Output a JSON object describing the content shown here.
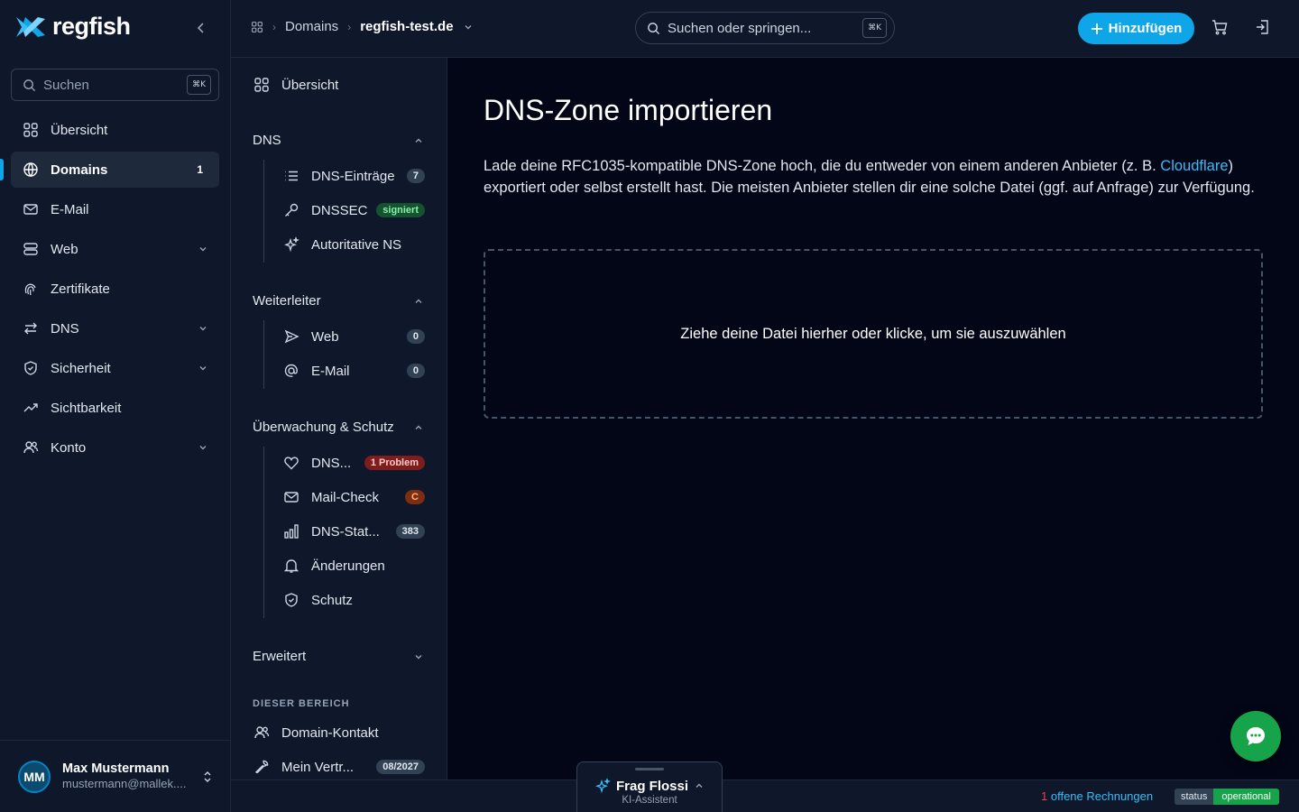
{
  "brand": {
    "name": "regfish",
    "accent": "#0ea5e9"
  },
  "sidebar": {
    "search_label": "Suchen",
    "kbd": "⌘K",
    "items": [
      {
        "label": "Übersicht",
        "icon": "grid-icon"
      },
      {
        "label": "Domains",
        "icon": "globe-icon",
        "badge": "1",
        "active": true
      },
      {
        "label": "E-Mail",
        "icon": "mail-icon"
      },
      {
        "label": "Web",
        "icon": "server-icon",
        "expandable": true
      },
      {
        "label": "Zertifikate",
        "icon": "fingerprint-icon"
      },
      {
        "label": "DNS",
        "icon": "arrows-icon",
        "expandable": true
      },
      {
        "label": "Sicherheit",
        "icon": "shield-icon",
        "expandable": true
      },
      {
        "label": "Sichtbarkeit",
        "icon": "trend-icon"
      },
      {
        "label": "Konto",
        "icon": "users-icon",
        "expandable": true
      }
    ],
    "user": {
      "initials": "MM",
      "name": "Max Mustermann",
      "email": "mustermann@mallek...."
    }
  },
  "topbar": {
    "breadcrumb": [
      "Domains",
      "regfish-test.de"
    ],
    "search_placeholder": "Suchen oder springen...",
    "kbd": "⌘K",
    "add_label": "Hinzufügen"
  },
  "subnav": {
    "overview": "Übersicht",
    "dns": {
      "heading": "DNS",
      "items": [
        {
          "label": "DNS-Einträge",
          "badge": "7"
        },
        {
          "label": "DNSSEC",
          "badge": "signiert"
        },
        {
          "label": "Autoritative NS"
        }
      ]
    },
    "forwarder": {
      "heading": "Weiterleiter",
      "items": [
        {
          "label": "Web",
          "badge": "0"
        },
        {
          "label": "E-Mail",
          "badge": "0"
        }
      ]
    },
    "monitoring": {
      "heading": "Überwachung & Schutz",
      "items": [
        {
          "label": "DNS...",
          "badge": "1 Problem"
        },
        {
          "label": "Mail-Check",
          "badge": "C"
        },
        {
          "label": "DNS-Stat...",
          "badge": "383"
        },
        {
          "label": "Änderungen"
        },
        {
          "label": "Schutz"
        }
      ]
    },
    "advanced": "Erweitert",
    "section_label": "DIESER BEREICH",
    "section_items": [
      {
        "label": "Domain-Kontakt"
      },
      {
        "label": "Mein Vertr...",
        "badge": "08/2027"
      }
    ]
  },
  "main": {
    "title": "DNS-Zone importieren",
    "desc_before": "Lade deine RFC1035-kompatible DNS-Zone hoch, die du entweder von einem anderen Anbieter (z. B. ",
    "desc_link": "Cloudflare",
    "desc_after": ") exportiert oder selbst erstellt hast. Die meisten Anbieter stellen dir eine solche Datei (ggf. auf Anfrage) zur Verfügung.",
    "dropzone": "Ziehe deine Datei hierher oder klicke, um sie auszuwählen"
  },
  "footer": {
    "assistant_name": "Frag Flossi",
    "assistant_sub": "KI-Assistent",
    "invoice_count": "1",
    "invoice_label": " offene Rechnungen",
    "status_label": "status",
    "status_value": "operational"
  }
}
